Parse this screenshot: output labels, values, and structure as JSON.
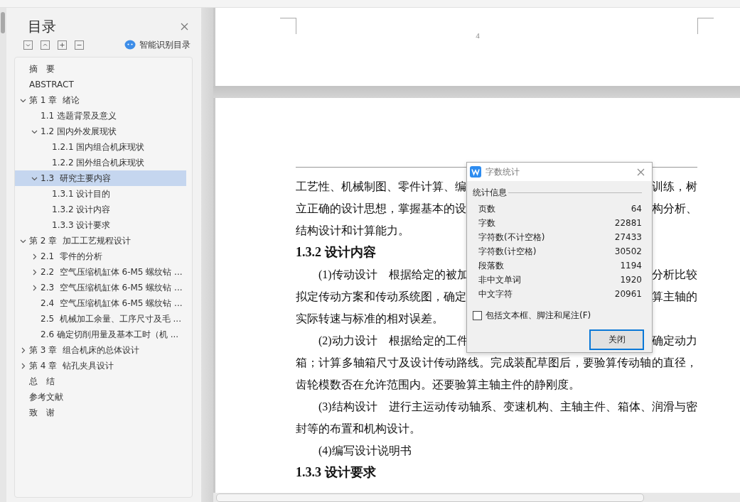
{
  "sidebar": {
    "title": "目录",
    "smart_toc_label": "智能识别目录",
    "toc_items": [
      {
        "label": "摘　要",
        "selected": false
      },
      {
        "label": "ABSTRACT",
        "selected": false
      },
      {
        "label": "第 1 章  绪论",
        "selected": false,
        "expanded": true,
        "children": [
          {
            "label": "1.1 选题背景及意义",
            "selected": false
          },
          {
            "label": "1.2 国内外发展现状",
            "selected": false,
            "expanded": true,
            "children": [
              {
                "label": "1.2.1 国内组合机床现状",
                "selected": false
              },
              {
                "label": "1.2.2 国外组合机床现状",
                "selected": false
              }
            ]
          },
          {
            "label": "1.3  研究主要内容",
            "selected": true,
            "expanded": true,
            "children": [
              {
                "label": "1.3.1 设计目的",
                "selected": false
              },
              {
                "label": "1.3.2 设计内容",
                "selected": false
              },
              {
                "label": "1.3.3 设计要求",
                "selected": false
              }
            ]
          }
        ]
      },
      {
        "label": "第 2 章  加工工艺规程设计",
        "selected": false,
        "expanded": true,
        "children": [
          {
            "label": "2.1  零件的分析",
            "selected": false,
            "expanded": false
          },
          {
            "label": "2.2  空气压缩机缸体 6-M5 螺纹钻 ...",
            "selected": false,
            "expanded": false
          },
          {
            "label": "2.3  空气压缩机缸体 6-M5 螺纹钻 ...",
            "selected": false,
            "expanded": false
          },
          {
            "label": "2.4  空气压缩机缸体 6-M5 螺纹钻 ...",
            "selected": false
          },
          {
            "label": "2.5  机械加工余量、工序尺寸及毛 ...",
            "selected": false
          },
          {
            "label": "2.6 确定切削用量及基本工时（机 ...",
            "selected": false
          }
        ]
      },
      {
        "label": "第 3 章  组合机床的总体设计",
        "selected": false,
        "expanded": false
      },
      {
        "label": "第 4 章  钻孔夹具设计",
        "selected": false,
        "expanded": false
      },
      {
        "label": "总　结",
        "selected": false
      },
      {
        "label": "参考文献",
        "selected": false
      },
      {
        "label": "致　谢",
        "selected": false
      }
    ]
  },
  "document": {
    "page_number": "4",
    "blocks": [
      {
        "kind": "line",
        "left": "工艺性、机械制图、零件计算、编",
        "right": "训练，树"
      },
      {
        "kind": "line",
        "left": "立正确的设计思想，掌握基本的设",
        "right": "构分析、"
      },
      {
        "kind": "end_line",
        "left": "结构设计和计算能力。"
      },
      {
        "kind": "heading",
        "left": "1.3.2 设计内容"
      },
      {
        "kind": "first_line",
        "left": "(1)传动设计　根据给定的被加",
        "right": "分析比较"
      },
      {
        "kind": "line",
        "left": "拟定传动方案和传动系统图，确定",
        "right": "算主轴的"
      },
      {
        "kind": "end_line",
        "left": "实际转速与标准的相对误差。"
      },
      {
        "kind": "first_line",
        "left": "(2)动力设计　根据给定的工件",
        "right": "确定动力"
      },
      {
        "kind": "line",
        "left": "箱；计算多轴箱尺寸及设计传动路线。完成装配草图后，要验算传动轴的直径，"
      },
      {
        "kind": "end_line",
        "left": "齿轮模数否在允许范围内。还要验算主轴主件的静刚度。"
      },
      {
        "kind": "first_line",
        "left": "(3)结构设计　进行主运动传动轴系、变速机构、主轴主件、箱体、润滑与密"
      },
      {
        "kind": "end_line",
        "left": "封等的布置和机构设计。"
      },
      {
        "kind": "first_end_line",
        "left": "(4)编写设计说明书"
      },
      {
        "kind": "heading",
        "left": "1.3.3 设计要求"
      }
    ]
  },
  "dialog": {
    "title": "字数统计",
    "group_label": "统计信息",
    "stats": [
      {
        "label": "页数",
        "value": "64"
      },
      {
        "label": "字数",
        "value": "22881"
      },
      {
        "label": "字符数(不计空格)",
        "value": "27433"
      },
      {
        "label": "字符数(计空格)",
        "value": "30502"
      },
      {
        "label": "段落数",
        "value": "1194"
      },
      {
        "label": "非中文单词",
        "value": "1920"
      },
      {
        "label": "中文字符",
        "value": "20961"
      }
    ],
    "checkbox": {
      "label": "包括文本框、脚注和尾注(F)",
      "checked": false
    },
    "close_button": "关闭"
  }
}
